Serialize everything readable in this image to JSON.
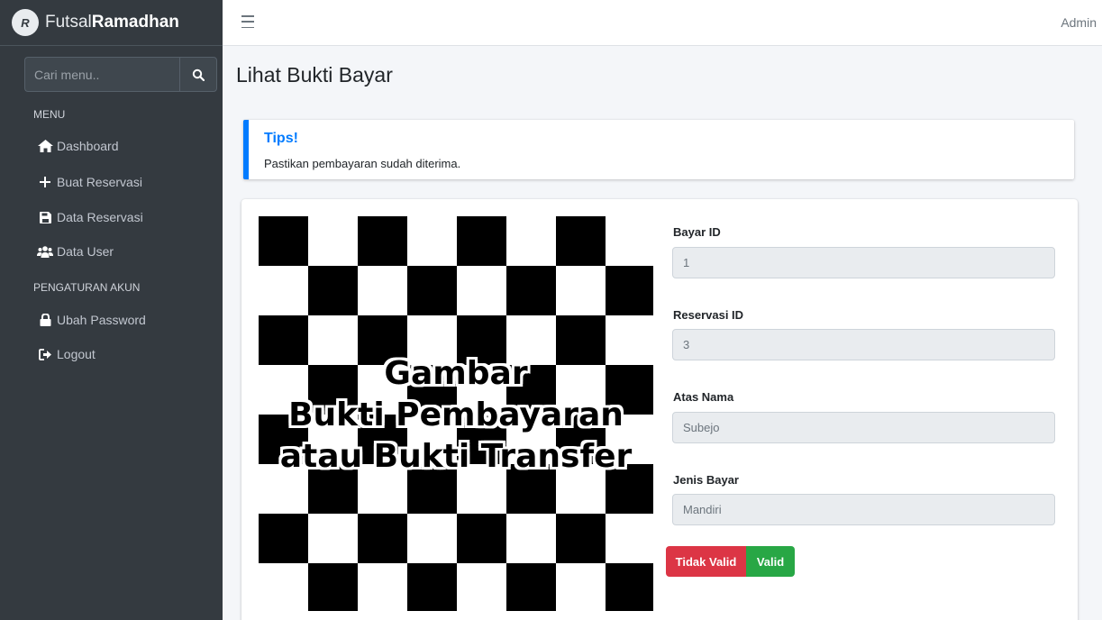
{
  "brand": {
    "logo_text": "R",
    "name_light": "Futsal",
    "name_bold": "Ramadhan"
  },
  "search": {
    "placeholder": "Cari menu.."
  },
  "sidebar": {
    "menu_header": "MENU",
    "items": [
      {
        "label": "Dashboard",
        "icon": "home-icon"
      },
      {
        "label": "Buat Reservasi",
        "icon": "plus-icon"
      },
      {
        "label": "Data Reservasi",
        "icon": "save-icon"
      },
      {
        "label": "Data User",
        "icon": "users-icon"
      }
    ],
    "account_header": "PENGATURAN AKUN",
    "account_items": [
      {
        "label": "Ubah Password",
        "icon": "lock-icon"
      },
      {
        "label": "Logout",
        "icon": "logout-icon"
      }
    ]
  },
  "header": {
    "user": "Admin"
  },
  "page": {
    "title": "Lihat Bukti Bayar"
  },
  "callout": {
    "title": "Tips!",
    "text": "Pastikan pembayaran sudah diterima."
  },
  "proof_image": {
    "line1": "Gambar",
    "line2": "Bukti Pembayaran",
    "line3": "atau Bukti Transfer"
  },
  "form": {
    "bayar_id": {
      "label": "Bayar ID",
      "value": "1"
    },
    "reservasi_id": {
      "label": "Reservasi ID",
      "value": "3"
    },
    "atas_nama": {
      "label": "Atas Nama",
      "value": "Subejo"
    },
    "jenis_bayar": {
      "label": "Jenis Bayar",
      "value": "Mandiri"
    }
  },
  "actions": {
    "invalid_label": "Tidak Valid",
    "valid_label": "Valid"
  },
  "colors": {
    "sidebar": "#343a40",
    "primary": "#007bff",
    "danger": "#dc3545",
    "success": "#28a745"
  }
}
